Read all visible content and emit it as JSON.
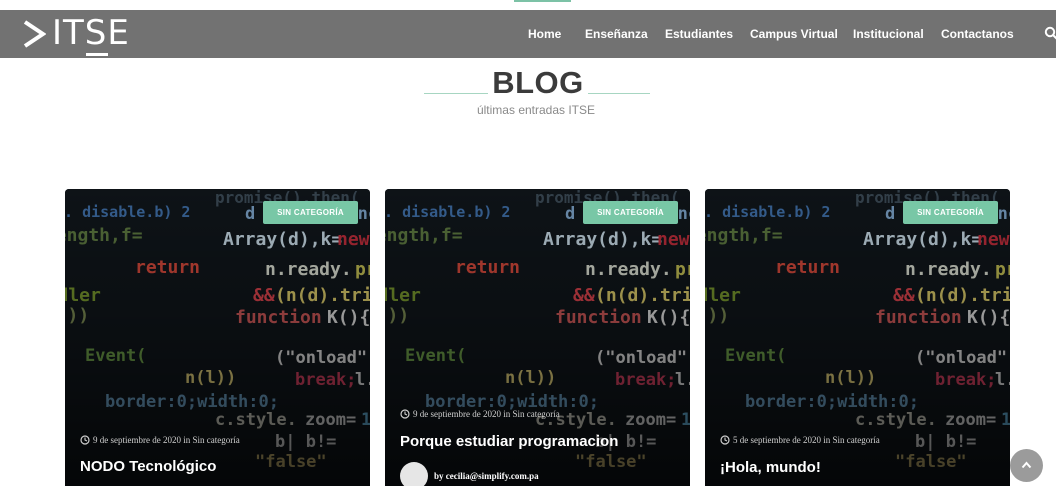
{
  "brand": {
    "logo_text": "ITSE"
  },
  "nav": {
    "items": [
      {
        "label": "Home",
        "active": true
      },
      {
        "label": "Enseñanza"
      },
      {
        "label": "Estudiantes"
      },
      {
        "label": "Campus Virtual"
      },
      {
        "label": "Institucional"
      },
      {
        "label": "Contactanos"
      }
    ],
    "search_icon": "search-icon"
  },
  "blog": {
    "title": "BLOG",
    "subtitle": "últimas entradas ITSE"
  },
  "posts": [
    {
      "category": "SIN CATEGORÍA",
      "meta": "9 de septiembre de 2020 in Sin categoría",
      "title": "NODO Tecnológico",
      "author": ""
    },
    {
      "category": "SIN CATEGORÍA",
      "meta": "9 de septiembre de 2020 in Sin categoría",
      "title": "Porque estudiar programacion",
      "author": "by cecilia@simplify.com.pa"
    },
    {
      "category": "SIN CATEGORÍA",
      "meta": "5 de septiembre de 2020 in Sin categoría",
      "title": "¡Hola, mundo!",
      "author": ""
    }
  ],
  "colors": {
    "navbar": "#727272",
    "accent": "#78c7a6",
    "title": "#3b3b3b"
  }
}
